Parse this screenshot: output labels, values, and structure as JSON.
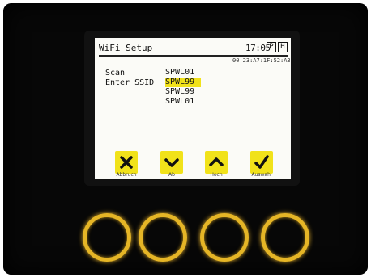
{
  "header": {
    "title": "WiFi Setup",
    "time": "17:05",
    "status_p": "P",
    "status_h": "H",
    "mac": "00:23:A7:1F:52:A3"
  },
  "menu": {
    "items": [
      "Scan",
      "Enter SSID"
    ]
  },
  "ssid_list": {
    "items": [
      "SPWL01",
      "SPWL99",
      "SPWL99",
      "SPWL01"
    ],
    "selected_index": 1,
    "highlight_color": "#f1e21a"
  },
  "softkeys": [
    {
      "icon": "x-icon",
      "label": "Abbruch"
    },
    {
      "icon": "chevron-down-icon",
      "label": "Ab"
    },
    {
      "icon": "chevron-up-icon",
      "label": "Hoch"
    },
    {
      "icon": "checkmark-icon",
      "label": "Auswahl"
    }
  ],
  "hardware_buttons": {
    "count": 4,
    "ring_color": "#e5b526"
  }
}
